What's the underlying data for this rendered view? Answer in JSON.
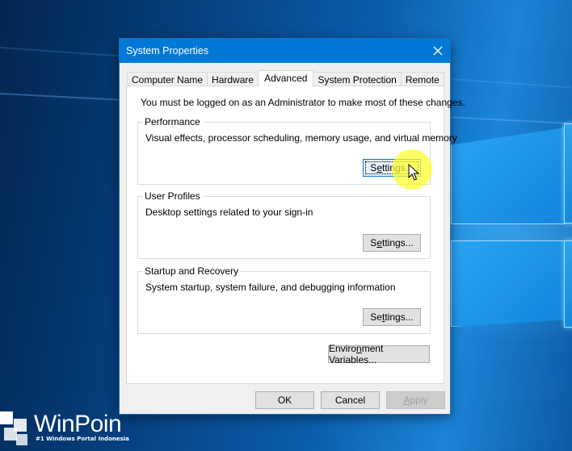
{
  "dialog": {
    "title": "System Properties",
    "close_icon": "close-icon"
  },
  "tabs": [
    {
      "label": "Computer Name",
      "active": false
    },
    {
      "label": "Hardware",
      "active": false
    },
    {
      "label": "Advanced",
      "active": true
    },
    {
      "label": "System Protection",
      "active": false
    },
    {
      "label": "Remote",
      "active": false
    }
  ],
  "advanced": {
    "admin_note": "You must be logged on as an Administrator to make most of these changes.",
    "performance": {
      "label": "Performance",
      "description": "Visual effects, processor scheduling, memory usage, and virtual memory",
      "button_pre": "S",
      "button_ul": "e",
      "button_post": "ttings..."
    },
    "user_profiles": {
      "label": "User Profiles",
      "description": "Desktop settings related to your sign-in",
      "button_pre": "S",
      "button_ul": "e",
      "button_post": "ttings..."
    },
    "startup_recovery": {
      "label": "Startup and Recovery",
      "description": "System startup, system failure, and debugging information",
      "button_pre": "Se",
      "button_ul": "t",
      "button_post": "tings..."
    },
    "env_button_pre": "Enviro",
    "env_button_ul": "n",
    "env_button_post": "ment Variables..."
  },
  "footer": {
    "ok": "OK",
    "cancel": "Cancel",
    "apply_ul": "A",
    "apply_post": "pply",
    "apply_enabled": false
  },
  "watermark": {
    "brand": "WinPoin",
    "tagline": "#1 Windows Portal Indonesia"
  },
  "colors": {
    "titlebar": "#0078d7",
    "focus": "#0078d7",
    "cursor_highlight": "#ffff28"
  }
}
